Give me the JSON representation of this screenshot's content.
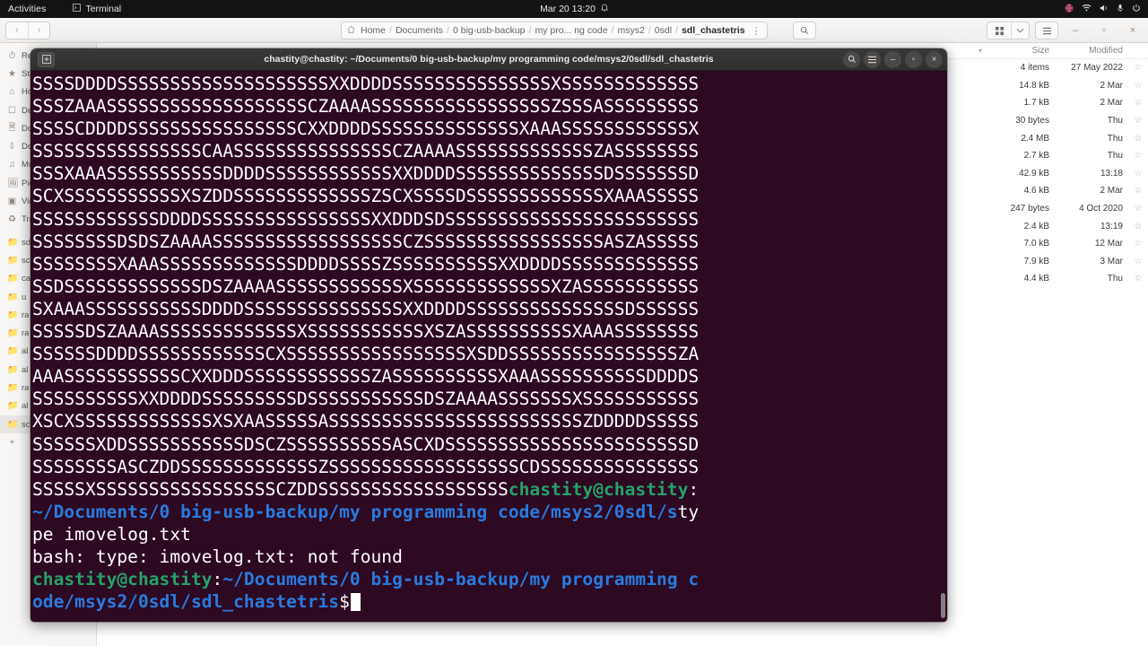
{
  "topbar": {
    "activities": "Activities",
    "app_name": "Terminal",
    "app_icon": "terminal-icon",
    "clock": "Mar 20  13:20",
    "notification_icon": "bell-icon",
    "status_icons": [
      "globe-icon",
      "wifi-icon",
      "volume-icon",
      "microphone-icon",
      "power-icon"
    ]
  },
  "filemanager": {
    "back_icon": "chevron-left-icon",
    "forward_icon": "chevron-right-icon",
    "breadcrumb": [
      {
        "label": "Home",
        "icon": "home-icon",
        "current": false
      },
      {
        "label": "Documents",
        "current": false
      },
      {
        "label": "0 big-usb-backup",
        "current": false
      },
      {
        "label": "my pro... ng code",
        "current": false
      },
      {
        "label": "msys2",
        "current": false
      },
      {
        "label": "0sdl",
        "current": false
      },
      {
        "label": "sdl_chastetris",
        "current": true
      }
    ],
    "path_menu_icon": "kebab-menu-icon",
    "search_icon": "search-icon",
    "view_grid_icon": "grid-view-icon",
    "view_chevron_icon": "chevron-down-icon",
    "menu_icon": "hamburger-menu-icon",
    "window_minimize": "–",
    "window_maximize": "▫",
    "window_close": "×",
    "sidebar": [
      {
        "label": "Recent",
        "icon": "clock-icon"
      },
      {
        "label": "Starred",
        "icon": "star-icon"
      },
      {
        "label": "Home",
        "icon": "home-icon"
      },
      {
        "label": "Desktop",
        "icon": "desktop-icon"
      },
      {
        "label": "Documents",
        "icon": "document-icon"
      },
      {
        "label": "Downloads",
        "icon": "download-icon"
      },
      {
        "label": "Music",
        "icon": "music-note-icon"
      },
      {
        "label": "Pictures",
        "icon": "picture-icon"
      },
      {
        "label": "Videos",
        "icon": "video-icon"
      },
      {
        "label": "Trash",
        "icon": "trash-icon"
      },
      {
        "label": "sd",
        "icon": "folder-icon"
      },
      {
        "label": "sc",
        "icon": "folder-icon"
      },
      {
        "label": "ca",
        "icon": "folder-icon"
      },
      {
        "label": "u",
        "icon": "folder-icon"
      },
      {
        "label": "ra",
        "icon": "folder-icon"
      },
      {
        "label": "ra",
        "icon": "folder-icon"
      },
      {
        "label": "al",
        "icon": "folder-icon"
      },
      {
        "label": "al",
        "icon": "folder-icon"
      },
      {
        "label": "ra",
        "icon": "folder-icon"
      },
      {
        "label": "al",
        "icon": "folder-icon"
      },
      {
        "label": "sc",
        "icon": "folder-icon",
        "selected": true
      }
    ],
    "sidebar_add_label": "+",
    "columns": {
      "name": "",
      "size": "Size",
      "modified": "Modified",
      "sort_icon": "chevron-down-icon",
      "star_icon": "star-outline-icon"
    },
    "rows": [
      {
        "size": "4 items",
        "modified": "27 May 2022"
      },
      {
        "size": "14.8 kB",
        "modified": "2 Mar"
      },
      {
        "size": "1.7 kB",
        "modified": "2 Mar"
      },
      {
        "size": "30 bytes",
        "modified": "Thu"
      },
      {
        "size": "2.4 MB",
        "modified": "Thu"
      },
      {
        "size": "2.7 kB",
        "modified": "Thu"
      },
      {
        "size": "42.9 kB",
        "modified": "13:18"
      },
      {
        "size": "4.6 kB",
        "modified": "2 Mar"
      },
      {
        "size": "247 bytes",
        "modified": "4 Oct 2020"
      },
      {
        "size": "2.4 kB",
        "modified": "13:19"
      },
      {
        "size": "7.0 kB",
        "modified": "12 Mar"
      },
      {
        "size": "7.9 kB",
        "modified": "3 Mar"
      },
      {
        "size": "4.4 kB",
        "modified": "Thu"
      }
    ]
  },
  "terminal": {
    "new_tab_icon": "new-tab-icon",
    "title": "chastity@chastity: ~/Documents/0 big-usb-backup/my programming code/msys2/0sdl/sdl_chastetris",
    "search_icon": "search-icon",
    "menu_icon": "hamburger-menu-icon",
    "minimize": "–",
    "maximize": "▫",
    "close": "×",
    "colors": {
      "background": "#2d0922",
      "foreground": "#ffffff",
      "prompt_user": "#26a269",
      "prompt_path": "#2a7bde"
    },
    "scrollback": [
      "SSSSSSSSSSSDDDDSSSSSSSSSSSSSXXDDDDSSSSSSSSSDSSSSSSSSSSSSSDSZAAAASSSSSSSXSSSSSSSSSSSXSC",
      "XSSSSSSSSSSSSSXSXAASSSSSASSSSSSSSSSSSSSSSSSSSSSSSSSSSZDDDDDSSSSSSSSSSSSXDDSSSSSSSSSSS",
      "DSCZSSSSSSSSSSASCXDSSSSSSSSSSSSSSSSSSSSSSSDSSSSSSSASCZDDSSSSSSSSSSSSSZSSSSSSSSS",
      "SSSSSSSSSSSCDSSSSSSSSSSSSSSSSSXSSSSSSSSSSSSSSSSSSSCZDDSSSSSSSSSSSSSSSSSSSSSSSSSSSS",
      "SSSSSSSSSSSZASSSSSSSSSSSSSSSSDDDDSSSSSSSSSSSSSSSSSDDDDSSSSSSSSSSSSSSSSSSSSXXD",
      "DDDSSSSSSSSSSSSSSSXSSSSSSSSSSSSSSSSZAAASSSSSSSSSSSSSSSSSSSCZAAAASSSSSSSSSSSSSSSS",
      "SZSSSASSSSSSSSSSSSSCDDDDSSSSSSSSSSSSSSSSCXXDDDDSSSSSSSSSSSSSSXAAASSSSSSSSSSSSXSS",
      "SSSSSSSSSSSSSSCAASSSSSSSSSSSSSSSCZAAAASSSSSSSSSSSSSZASSSSSSSSSSSXAAASSSSSSSSSSSDDD",
      "DSSSSSSSSSSSSXXDDDDSSSSSSSSSSSSSSDSSSSSSSDSCXSSSSSSSSSSSXSZDDSSSSSSSSSSSSSZSCXS",
      "SSSDSSSSSSSSSSSSSXAAASSSSSSSSSSSSSSSSSDDDDSSSSSSSSSSSSSSSSXXDDDSDSSSSSSSSSSSSSSSS",
      "SSSSSSSSSSSSSSSSDSDSZAAAASSSSSSSSSSSSSSSSSSCZSSSSSSSSSSSSSSSSSASZASSSSSSSSSSSSSXAAAS",
      "SSSSSSSSSSSSDDDDSSSSZSSSSSSSSSSXXDDDDSSSSSSSSSSSSSSSDSSSSSSSSSSSSSDSZAAAASSSSSSSSS",
      "SSSXSSSSSSSSSSSSSXZASSSSSSSSSSSSXAAASSSSSSSSSSSDDDDSSSSSSSSSSSSSSSXXDDDDSSSSSSSSS",
      "SSSSSSDSSSSSSSSSSSDSZAAAASSSSSSSSSSSSSXSSSSSSSSSSSXSZASSSSSSSSSSXAAASSSSSSSSSSSSSSDD",
      "DDSSSSSSSSSSSSCXSSSSSSSSSSSSSSSSSXSDDSSSSSSSSSSSSSSSSZAAAASSSSSSSSSSSCXXDDDSSSSSS",
      "SSSSSSZASSSSSSSSSSXAAASSSSSSSSSSDDDDSSSSSSSSSSSXXDDDDSSSSSSSSSDSSSSSSSSSSSDSZAAA",
      "ASSSSSSSXSSSSSSSSSSSXSCXSSSSSSSSSSSSSXSXAASSSSSASSSSSSSSSSSSSSSSSSSSSSSSZDDDDDSS",
      "SSSSSSSSSXDDSSSSSSSSSSSDSCZSSSSSSSSSSASCXDSSSSSSSSSSSSSSSSSSSSSSSDSSSSSSSSASCZDDS",
      "SSSSSSSSSSSSZSSSSSSSSSSSSSSSSSSCDSSSSSSSSSSSSSSSSSSSSXSSSSSSSSSSSSSSSSSCZDDSSS"
    ],
    "prompt_filler": "SSSSSSSSSSSSSSS",
    "command_line": {
      "user_host": "chastity@chastity",
      "colon": ":",
      "path": "~/Documents/0 big-usb-backup/my programming code/msys2/0sdl/s",
      "command": "type imovelog.txt"
    },
    "output": "bash: type: imovelog.txt: not found",
    "final_prompt": {
      "user_host": "chastity@chastity",
      "colon": ":",
      "path": "~/Documents/0 big-usb-backup/my programming code/msys2/0sdl/sdl_chastetris",
      "dollar": "$"
    }
  }
}
